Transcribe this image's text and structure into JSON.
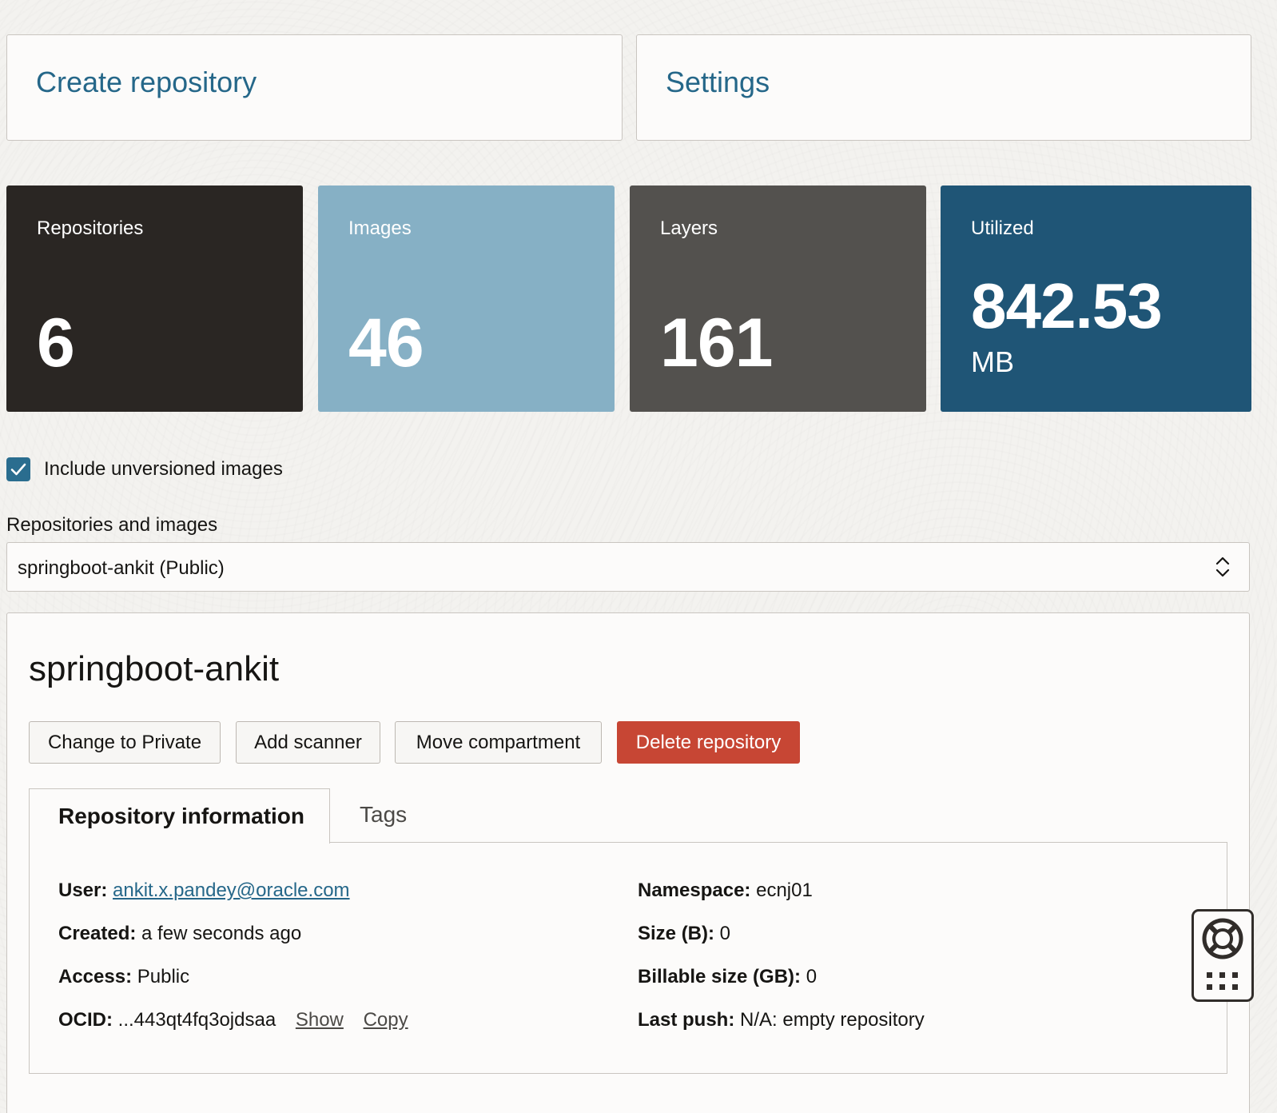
{
  "actions": {
    "create_repository": "Create repository",
    "settings": "Settings"
  },
  "stats": {
    "repositories": {
      "label": "Repositories",
      "value": "6",
      "color": "#2a2623"
    },
    "images": {
      "label": "Images",
      "value": "46",
      "color": "#86b0c5"
    },
    "layers": {
      "label": "Layers",
      "value": "161",
      "color": "#53514e"
    },
    "utilized": {
      "label": "Utilized",
      "value": "842.53",
      "unit": "MB",
      "color": "#1f5576"
    }
  },
  "filter": {
    "include_unversioned_label": "Include unversioned images",
    "include_unversioned_checked": true
  },
  "selector": {
    "label": "Repositories and images",
    "value": "springboot-ankit (Public)"
  },
  "repo": {
    "name": "springboot-ankit",
    "buttons": {
      "change_private": "Change to Private",
      "add_scanner": "Add scanner",
      "move_compartment": "Move compartment",
      "delete": "Delete repository"
    },
    "tabs": {
      "info": "Repository information",
      "tags": "Tags"
    },
    "info": {
      "user_label": "User:",
      "user_value": "ankit.x.pandey@oracle.com",
      "created_label": "Created:",
      "created_value": "a few seconds ago",
      "access_label": "Access:",
      "access_value": "Public",
      "ocid_label": "OCID:",
      "ocid_value": "...443qt4fq3ojdsaa",
      "ocid_show": "Show",
      "ocid_copy": "Copy",
      "namespace_label": "Namespace:",
      "namespace_value": "ecnj01",
      "size_label": "Size (B):",
      "size_value": "0",
      "billable_label": "Billable size (GB):",
      "billable_value": "0",
      "last_push_label": "Last push:",
      "last_push_value": "N/A: empty repository"
    }
  },
  "icons": {
    "checkbox": "checkmark-icon",
    "select": "chevron-up-down-icon",
    "help": "lifebuoy-icon",
    "grid": "grid-dots-icon"
  }
}
